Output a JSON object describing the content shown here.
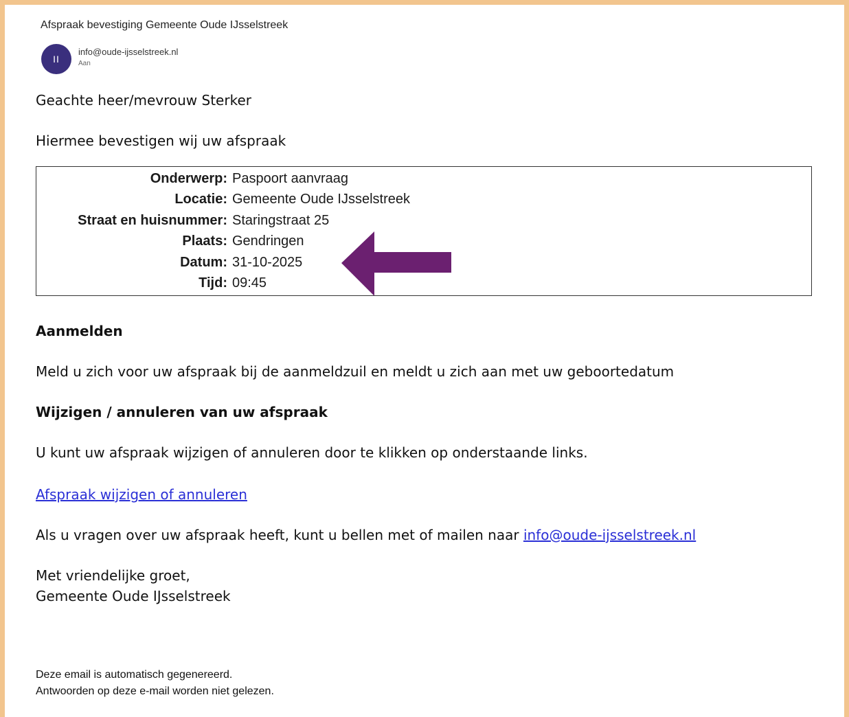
{
  "header": {
    "subject": "Afspraak bevestiging Gemeente Oude IJsselstreek",
    "avatar_initials": "II",
    "sender": "info@oude-ijsselstreek.nl",
    "to_label": "Aan"
  },
  "body": {
    "greeting": "Geachte heer/mevrouw Sterker",
    "intro": "Hiermee bevestigen wij uw afspraak",
    "details": [
      {
        "label": "Onderwerp:",
        "value": "Paspoort aanvraag"
      },
      {
        "label": "Locatie:",
        "value": "Gemeente Oude IJsselstreek"
      },
      {
        "label": "Straat en huisnummer:",
        "value": "Staringstraat 25"
      },
      {
        "label": "Plaats:",
        "value": "Gendringen"
      },
      {
        "label": "Datum:",
        "value": "31-10-2025"
      },
      {
        "label": "Tijd:",
        "value": "09:45"
      }
    ],
    "section1_heading": "Aanmelden",
    "section1_text": "Meld u zich voor uw afspraak bij de aanmeldzuil en meldt u zich aan met uw geboortedatum",
    "section2_heading": "Wijzigen / annuleren van uw afspraak",
    "section2_text": "U kunt uw afspraak wijzigen of annuleren door te klikken op onderstaande links.",
    "change_link": "Afspraak wijzigen of annuleren",
    "contact_text": "Als u vragen over uw afspraak heeft, kunt u bellen met of mailen naar ",
    "contact_email": "info@oude-ijsselstreek.nl",
    "closing": "Met vriendelijke groet,",
    "signature": "Gemeente Oude IJsselstreek"
  },
  "footer": {
    "line1": "Deze email is automatisch gegenereerd.",
    "line2": "Antwoorden op deze e-mail worden niet gelezen."
  },
  "colors": {
    "frame": "#f2c58e",
    "avatar": "#3a2f7d",
    "arrow": "#6b2070",
    "link": "#2a2fd6"
  }
}
